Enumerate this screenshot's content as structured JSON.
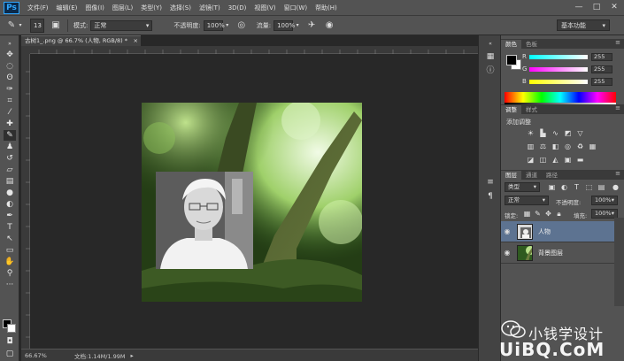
{
  "app": {
    "logo": "Ps"
  },
  "menu": [
    "文件(F)",
    "编辑(E)",
    "图像(I)",
    "图层(L)",
    "类型(Y)",
    "选择(S)",
    "滤镜(T)",
    "3D(D)",
    "视图(V)",
    "窗口(W)",
    "帮助(H)"
  ],
  "window_controls": {
    "minimize": "—",
    "maximize": "□",
    "close": "✕"
  },
  "options": {
    "brush_size": "13",
    "mode_label": "模式:",
    "mode_value": "正常",
    "opacity_label": "不透明度:",
    "opacity_value": "100%",
    "flow_label": "流量:",
    "flow_value": "100%",
    "workspace": "基本功能"
  },
  "document": {
    "tab_title": "古树1_.png @ 66.7% (人物, RGB/8) *",
    "close_glyph": "×"
  },
  "status": {
    "zoom": "66.67%",
    "doc_size": "文档:1.14M/1.99M",
    "arrow": "▸"
  },
  "color_panel": {
    "tabs": [
      "颜色",
      "色板"
    ],
    "channels": [
      {
        "label": "R",
        "value": "255"
      },
      {
        "label": "G",
        "value": "255"
      },
      {
        "label": "B",
        "value": "255"
      }
    ]
  },
  "adjustments_panel": {
    "tabs": [
      "调整",
      "样式"
    ],
    "title": "添加调整"
  },
  "layers_panel": {
    "tabs": [
      "图层",
      "通道",
      "路径"
    ],
    "filter_kind": "类型",
    "blend_mode": "正常",
    "opacity_label": "不透明度:",
    "opacity_value": "100%",
    "lock_label": "锁定:",
    "fill_label": "填充:",
    "fill_value": "100%",
    "layers": [
      {
        "name": "人物",
        "selected": true
      },
      {
        "name": "背景图层",
        "selected": false
      }
    ]
  },
  "watermark": {
    "text": "小钱学设计",
    "site": "UiBQ.CoM"
  },
  "colors": {
    "ui_dark": "#282828",
    "ui_panel": "#535353",
    "accent_selected": "#5d7391",
    "ps_blue": "#31a8ff"
  }
}
